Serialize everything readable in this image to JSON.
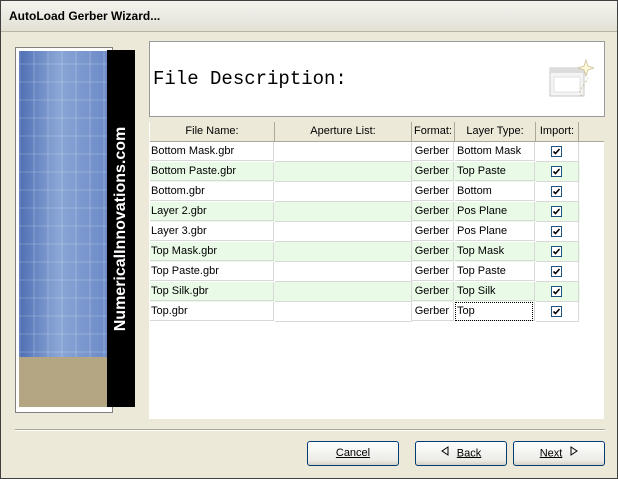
{
  "window": {
    "title": "AutoLoad Gerber Wizard..."
  },
  "banner": {
    "brand_text": "NumericalInnovations.com"
  },
  "header": {
    "title": "File Description:"
  },
  "table": {
    "columns": [
      "File Name:",
      "Aperture List:",
      "Format:",
      "Layer Type:",
      "Import:"
    ],
    "rows": [
      {
        "file": "Bottom Mask.gbr",
        "aperture": "",
        "format": "Gerber",
        "layer": "Bottom Mask",
        "import": true
      },
      {
        "file": "Bottom Paste.gbr",
        "aperture": "",
        "format": "Gerber",
        "layer": "Top Paste",
        "import": true
      },
      {
        "file": "Bottom.gbr",
        "aperture": "",
        "format": "Gerber",
        "layer": "Bottom",
        "import": true
      },
      {
        "file": "Layer 2.gbr",
        "aperture": "",
        "format": "Gerber",
        "layer": "Pos Plane",
        "import": true
      },
      {
        "file": "Layer 3.gbr",
        "aperture": "",
        "format": "Gerber",
        "layer": "Pos Plane",
        "import": true
      },
      {
        "file": "Top Mask.gbr",
        "aperture": "",
        "format": "Gerber",
        "layer": "Top Mask",
        "import": true
      },
      {
        "file": "Top Paste.gbr",
        "aperture": "",
        "format": "Gerber",
        "layer": "Top Paste",
        "import": true
      },
      {
        "file": "Top Silk.gbr",
        "aperture": "",
        "format": "Gerber",
        "layer": "Top Silk",
        "import": true
      },
      {
        "file": "Top.gbr",
        "aperture": "",
        "format": "Gerber",
        "layer": "Top",
        "import": true
      }
    ]
  },
  "buttons": {
    "cancel": "Cancel",
    "back": "Back",
    "next": "Next"
  },
  "colors": {
    "alt_row": "#e9fbe7",
    "banner_blue": "#6c8ac7",
    "banner_tan": "#b4a682",
    "button_border": "#003c74"
  },
  "icons": {
    "header": "window-sparkle-icon",
    "back": "triangle-left-icon",
    "next": "triangle-right-icon",
    "check": "check-icon"
  }
}
